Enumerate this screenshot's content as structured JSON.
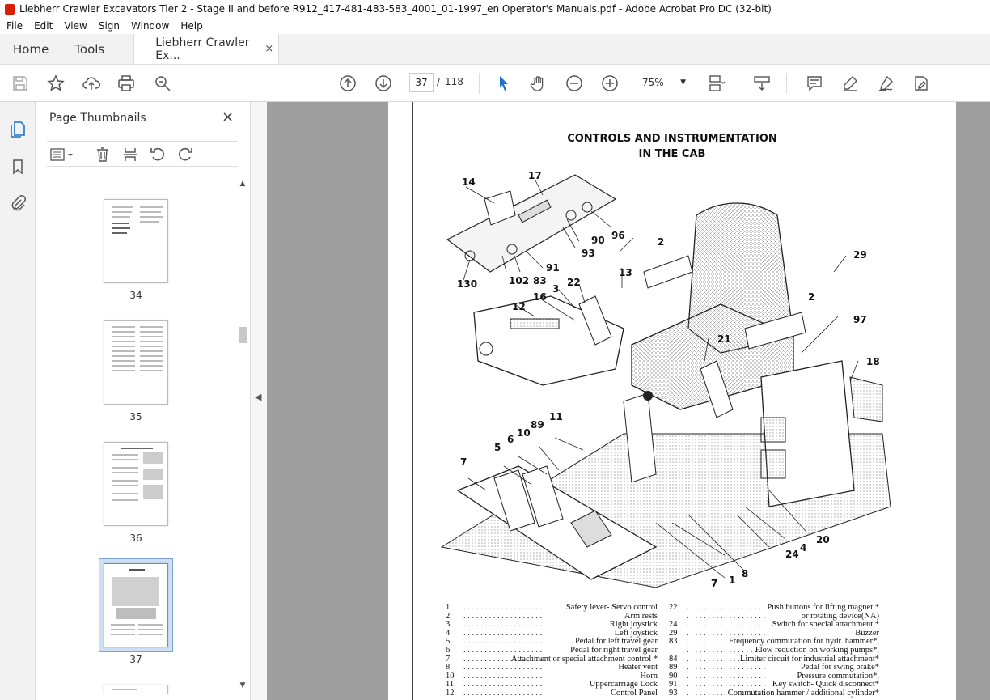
{
  "window": {
    "title": "Liebherr Crawler Excavators Tier 2 - Stage II and before  R912_417-481-483-583_4001_01-1997_en Operator's Manuals.pdf - Adobe Acrobat Pro DC (32-bit)"
  },
  "menu": [
    "File",
    "Edit",
    "View",
    "Sign",
    "Window",
    "Help"
  ],
  "tabs": {
    "home": "Home",
    "tools": "Tools",
    "document": "Liebherr Crawler Ex...",
    "close": "×"
  },
  "toolbar": {
    "current_page": "37",
    "page_sep": "/",
    "total_pages": "118",
    "zoom": "75%"
  },
  "thumbnail_panel": {
    "title": "Page Thumbnails",
    "close": "×",
    "pages": [
      {
        "label": "34",
        "selected": false
      },
      {
        "label": "35",
        "selected": false
      },
      {
        "label": "36",
        "selected": false
      },
      {
        "label": "37",
        "selected": true
      }
    ]
  },
  "document_page": {
    "title_line1": "CONTROLS AND INSTRUMENTATION",
    "title_line2": "IN THE CAB",
    "callouts": [
      "14",
      "17",
      "90",
      "96",
      "93",
      "2",
      "29",
      "91",
      "83",
      "102",
      "130",
      "13",
      "22",
      "3",
      "16",
      "12",
      "2",
      "97",
      "21",
      "18",
      "11",
      "89",
      "10",
      "6",
      "5",
      "7",
      "1",
      "8",
      "7",
      "24",
      "4",
      "20"
    ],
    "legend_left": [
      {
        "num": "1",
        "text": "Safety lever- Servo control"
      },
      {
        "num": "2",
        "text": "Arm rests"
      },
      {
        "num": "3",
        "text": "Right joystick"
      },
      {
        "num": "4",
        "text": "Left joystick"
      },
      {
        "num": "5",
        "text": "Pedal for left travel gear"
      },
      {
        "num": "6",
        "text": "Pedal for right travel gear"
      },
      {
        "num": "7",
        "text": "Attachment or special attachment control *"
      },
      {
        "num": "8",
        "text": "Heater vent"
      },
      {
        "num": "10",
        "text": "Horn"
      },
      {
        "num": "11",
        "text": "Uppercarriage Lock"
      },
      {
        "num": "12",
        "text": "Control Panel"
      }
    ],
    "legend_right": [
      {
        "num": "22",
        "text": "Push buttons for lifting magnet *"
      },
      {
        "num": "",
        "text": "or rotating device(NA)"
      },
      {
        "num": "24",
        "text": "Switch for special attachment *"
      },
      {
        "num": "29",
        "text": "Buzzer"
      },
      {
        "num": "83",
        "text": "Frequency commutation for hydr. hammer*,"
      },
      {
        "num": "",
        "text": "Flow reduction on working pumps*,"
      },
      {
        "num": "84",
        "text": "Limiter circuit for industrial attachment*"
      },
      {
        "num": "89",
        "text": "Pedal for swing brake*"
      },
      {
        "num": "90",
        "text": "Pressure commutation*,"
      },
      {
        "num": "91",
        "text": "Key switch- Quick disconnect*"
      },
      {
        "num": "93",
        "text": "Commutation hammer / additional cylinder*"
      }
    ]
  },
  "colors": {
    "acrobat_red": "#d81e05",
    "selection": "#cfe0f5",
    "viewer_bg": "#9e9e9e"
  }
}
